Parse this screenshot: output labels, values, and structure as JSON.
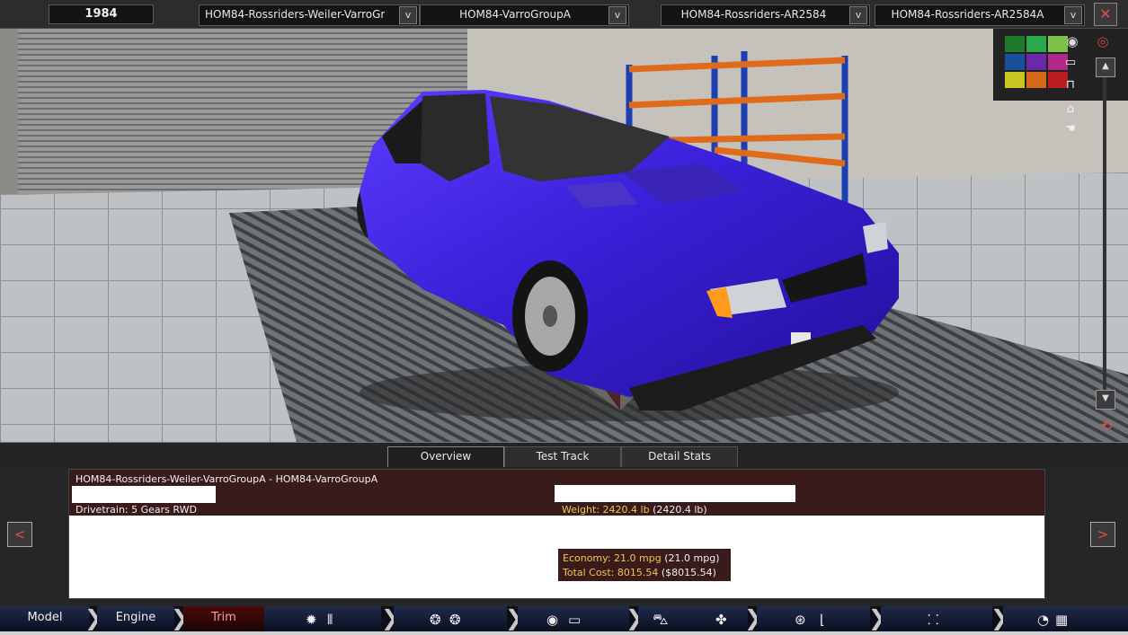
{
  "toolbar": {
    "year": "1984",
    "selectors": [
      {
        "value": "HOM84-Rossriders-Weiler-VarroGroupA"
      },
      {
        "value": "HOM84-VarroGroupA"
      },
      {
        "value": "HOM84-Rossriders-AR2584"
      },
      {
        "value": "HOM84-Rossriders-AR2584A"
      }
    ],
    "dropdown_glyph": "v",
    "close_glyph": "✕"
  },
  "viewport": {
    "car_color": "#3a20d8",
    "scroll_up_glyph": "▲",
    "scroll_down_glyph": "▼",
    "camera_icons": [
      "eye-icon",
      "car-front-icon",
      "car-side-icon",
      "car-rear-icon",
      "car-top-icon"
    ]
  },
  "tabs": [
    {
      "label": "Overview",
      "active": true
    },
    {
      "label": "Test Track",
      "active": false
    },
    {
      "label": "Detail Stats",
      "active": false
    }
  ],
  "overview": {
    "title": "HOM84-Rossriders-Weiler-VarroGroupA - HOM84-VarroGroupA",
    "drivetrain": "Drivetrain: 5 Gears RWD",
    "weight_main": "Weight: 2420.4 lb",
    "weight_paren": "(2420.4 lb)",
    "economy_main": "Economy: 21.0 mpg",
    "economy_paren": "(21.0 mpg)",
    "cost_main": "Total Cost: 8015.54",
    "cost_paren": "($8015.54)",
    "prev_glyph": "<",
    "next_glyph": ">"
  },
  "bottom_nav": {
    "items": [
      {
        "label": "Model"
      },
      {
        "label": "Engine"
      },
      {
        "label": "Trim"
      }
    ],
    "icon_groups": [
      {
        "icons": [
          "engine-icon",
          "gearbox-icon"
        ]
      },
      {
        "icons": [
          "wheel-icon",
          "wheel-icon"
        ]
      },
      {
        "icons": [
          "brake-icon",
          "chassis-icon"
        ]
      },
      {
        "icons": [
          "car-body-icon",
          "fan-icon"
        ]
      },
      {
        "icons": [
          "steering-wheel-icon",
          "seat-icon"
        ]
      },
      {
        "icons": [
          "suspension-icon"
        ]
      },
      {
        "icons": [
          "speedometer-icon",
          "checkered-flag-icon"
        ]
      }
    ],
    "chevron_glyph": "❯"
  }
}
